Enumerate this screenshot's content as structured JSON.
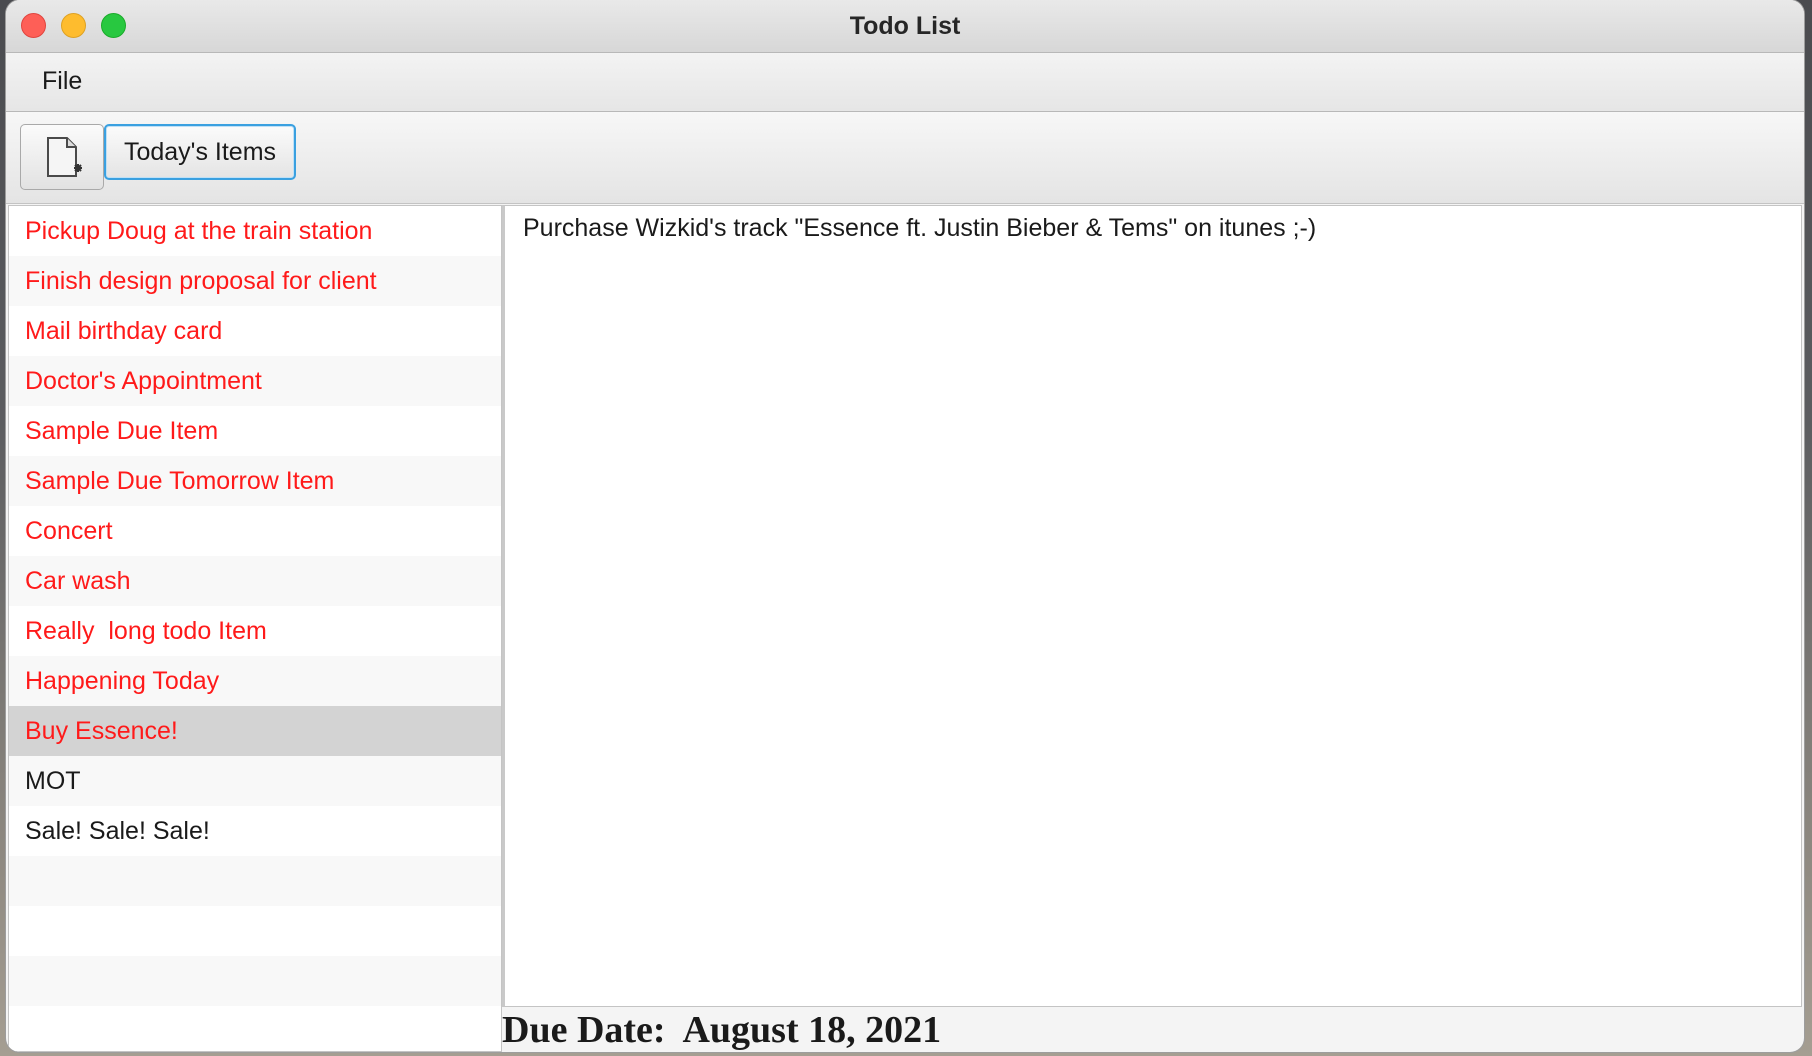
{
  "window": {
    "title": "Todo List"
  },
  "menu": {
    "file_label": "File"
  },
  "toolbar": {
    "new_item_icon": "new-document-icon",
    "today_label": "Today's Items"
  },
  "todo_list": {
    "items": [
      {
        "label": "Pickup Doug at the train station",
        "overdue": true
      },
      {
        "label": "Finish design proposal for client",
        "overdue": true
      },
      {
        "label": "Mail birthday card",
        "overdue": true
      },
      {
        "label": "Doctor's Appointment",
        "overdue": true
      },
      {
        "label": "Sample Due Item",
        "overdue": true
      },
      {
        "label": "Sample Due Tomorrow Item",
        "overdue": true
      },
      {
        "label": "Concert",
        "overdue": true
      },
      {
        "label": "Car wash",
        "overdue": true
      },
      {
        "label": "Really  long todo Item",
        "overdue": true
      },
      {
        "label": "Happening Today",
        "overdue": true
      },
      {
        "label": "Buy Essence!",
        "overdue": true,
        "selected": true
      },
      {
        "label": "MOT",
        "overdue": false
      },
      {
        "label": "Sale! Sale! Sale!",
        "overdue": false
      }
    ],
    "overdue_color": "#ff1a1a",
    "selected_row_color": "#d3d3d3"
  },
  "details": {
    "text": "Purchase Wizkid's track \"Essence ft. Justin Bieber & Tems\" on itunes ;-)"
  },
  "due_date": {
    "text": "Due Date:  August 18, 2021"
  }
}
